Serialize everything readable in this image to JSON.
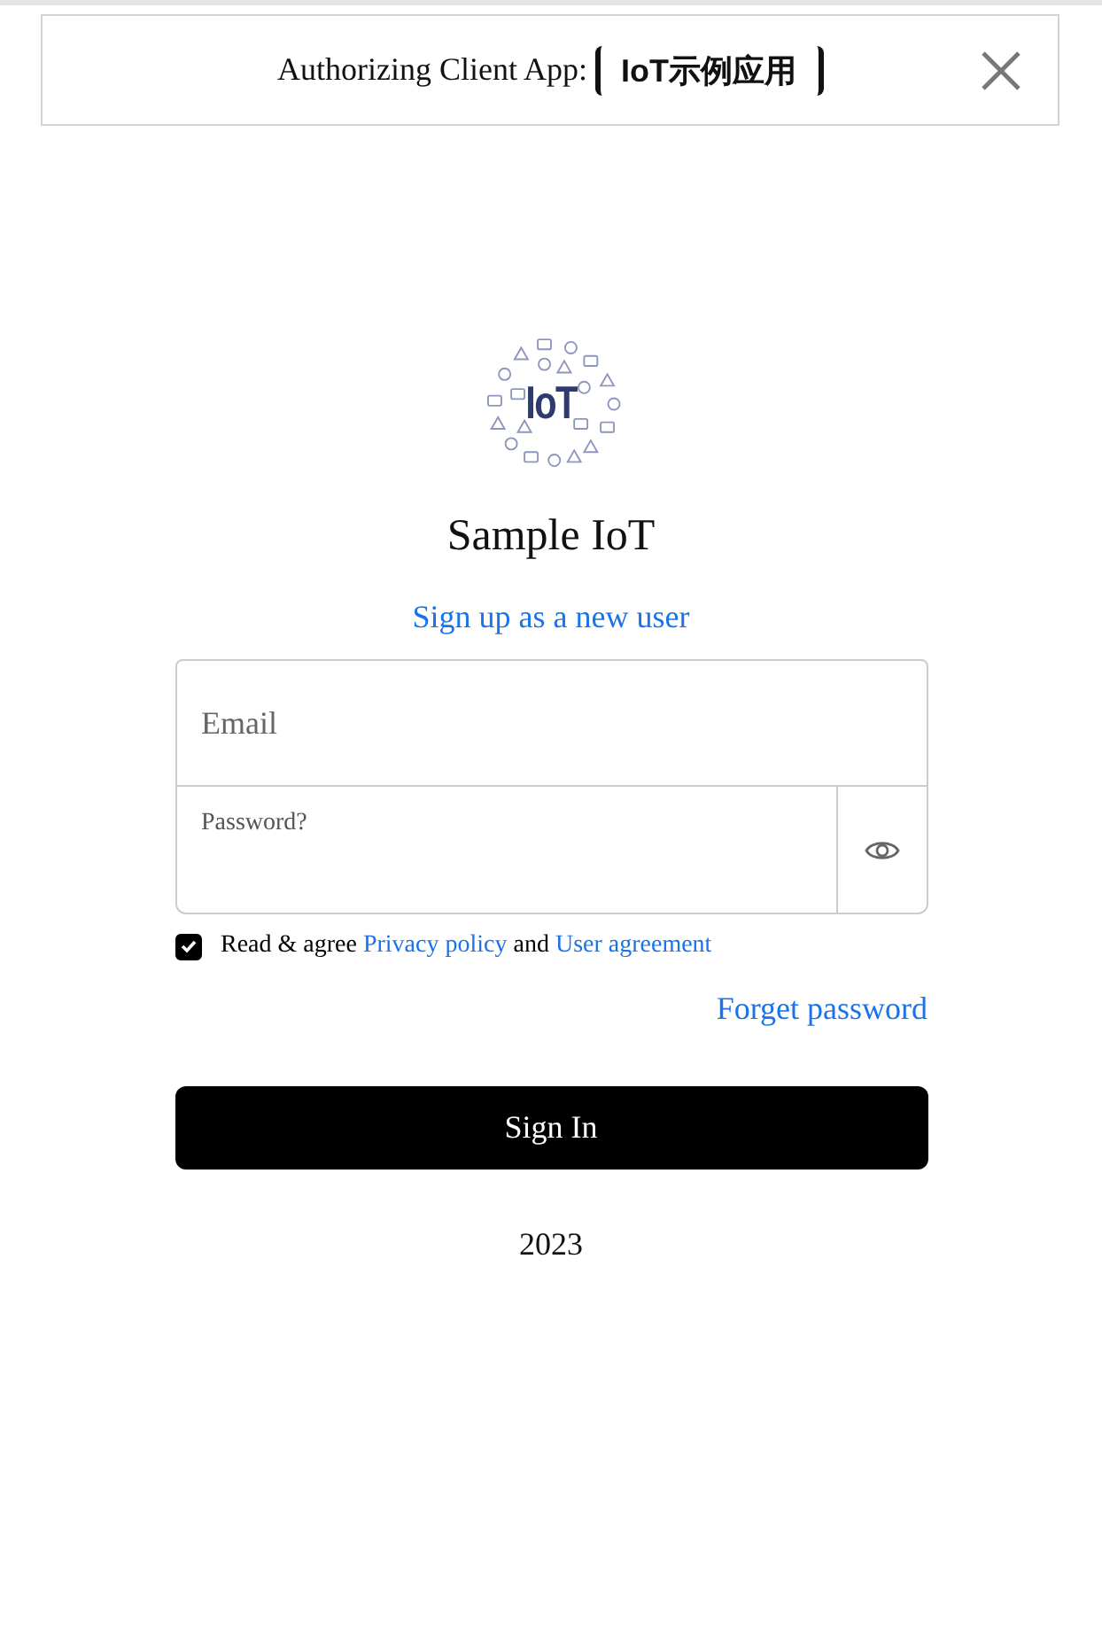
{
  "header": {
    "label": "Authorizing Client App:",
    "app_name": "IoT示例应用"
  },
  "logo": {
    "text": "IoT"
  },
  "title": "Sample IoT",
  "signup_link": "Sign up as a new user",
  "fields": [
    {
      "kind": "text",
      "placeholder": "Email"
    },
    {
      "kind": "password",
      "placeholder": "Password?"
    }
  ],
  "agreement": {
    "checked": true,
    "prefix": "Read & agree",
    "link_1": "Privacy policy",
    "middle": "and",
    "link_2": "User agreement"
  },
  "forgot_link": "Forget password",
  "submit": "Sign In",
  "footer": "2023"
}
